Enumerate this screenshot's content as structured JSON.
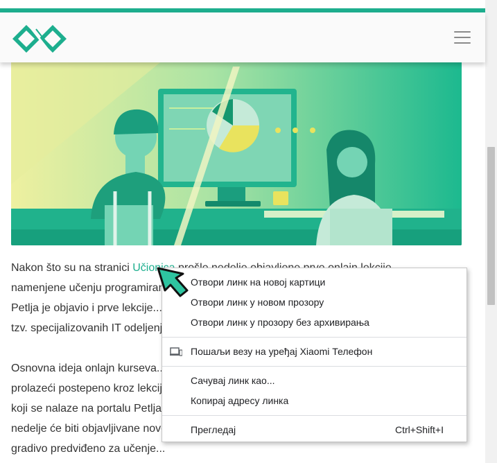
{
  "colors": {
    "accent": "#1dae8e",
    "text": "#333333",
    "link": "#1dae8e"
  },
  "header": {
    "logo_icon": "petlja-logo-icon",
    "menu_icon": "hamburger-menu-icon"
  },
  "hero": {
    "illustration": "hero-illustration"
  },
  "article": {
    "para1": {
      "lines": [
        {
          "before": "Nakon što su na stranici ",
          "link": "Učionica",
          "after": " prošle nedelje objavljene prve onlajn lekcije"
        },
        {
          "text": "namenjene učenju programiranja..."
        },
        {
          "text": "Petlja je objavio i prve lekcije..."
        },
        {
          "text": "tzv. specijalizovanih IT odeljenja..."
        }
      ]
    },
    "para2": {
      "lines": [
        {
          "text": "Osnovna ideja onlajn kurseva..."
        },
        {
          "text": "prolazeći postepeno kroz lekcije..."
        },
        {
          "text": "koji se nalaze na portalu Petlja..."
        },
        {
          "text": "nedelje će biti objavljivane nove..."
        },
        {
          "text": "gradivo predviđeno za učenje..."
        }
      ]
    }
  },
  "context_menu": {
    "open_new_tab": "Отвори линк на новој картици",
    "open_new_window": "Отвори линк у новом прозору",
    "open_incognito": "Отвори линк у прозору без архивирања",
    "send_to_device": "Пошаљи везу на уређај Xiaomi Телефон",
    "save_link_as": "Сачувај линк као...",
    "copy_link": "Копирај адресу линка",
    "inspect": "Прегледај",
    "inspect_shortcut": "Ctrl+Shift+I",
    "device_icon": "devices-icon"
  }
}
